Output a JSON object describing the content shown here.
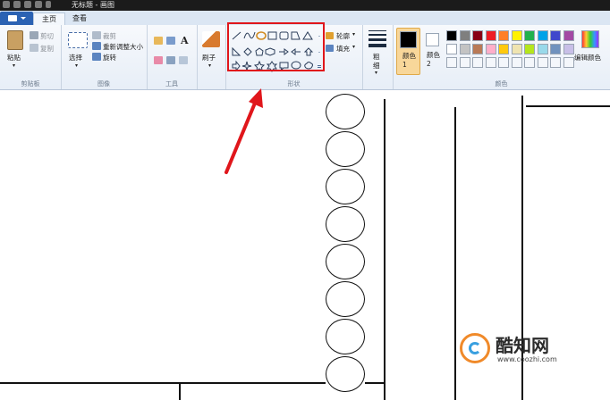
{
  "window": {
    "title": "无标题 - 画图"
  },
  "tabs": {
    "home": "主页",
    "view": "查看"
  },
  "clipboard": {
    "paste": "粘贴",
    "cut": "剪切",
    "copy": "复制",
    "label": "剪贴板"
  },
  "image": {
    "select": "选择",
    "crop": "裁剪",
    "resize": "重新调整大小",
    "rotate": "旋转",
    "label": "图像"
  },
  "tools": {
    "label": "工具",
    "text_glyph": "A"
  },
  "brushes": {
    "label": "刷子"
  },
  "shapes": {
    "outline": "轮廓",
    "fill": "填充",
    "label": "形状"
  },
  "size": {
    "label": "粗细"
  },
  "colors": {
    "color1": "颜色 1",
    "color2": "颜色 2",
    "edit": "编辑颜色",
    "label": "颜色",
    "color1_value": "#000000",
    "color2_value": "#ffffff",
    "palette_row1": [
      "#000000",
      "#7f7f7f",
      "#880015",
      "#ed1c24",
      "#ff7f27",
      "#fff200",
      "#22b14c",
      "#00a2e8",
      "#3f48cc",
      "#a349a4"
    ],
    "palette_row2": [
      "#ffffff",
      "#c3c3c3",
      "#b97a57",
      "#ffaec9",
      "#ffc90e",
      "#efe4b0",
      "#b5e61d",
      "#99d9ea",
      "#7092be",
      "#c8bfe7"
    ]
  },
  "watermark": {
    "brand": "酷知网",
    "url": "www.coozhi.com"
  },
  "annotation": {
    "highlight_color": "#e0161b"
  }
}
